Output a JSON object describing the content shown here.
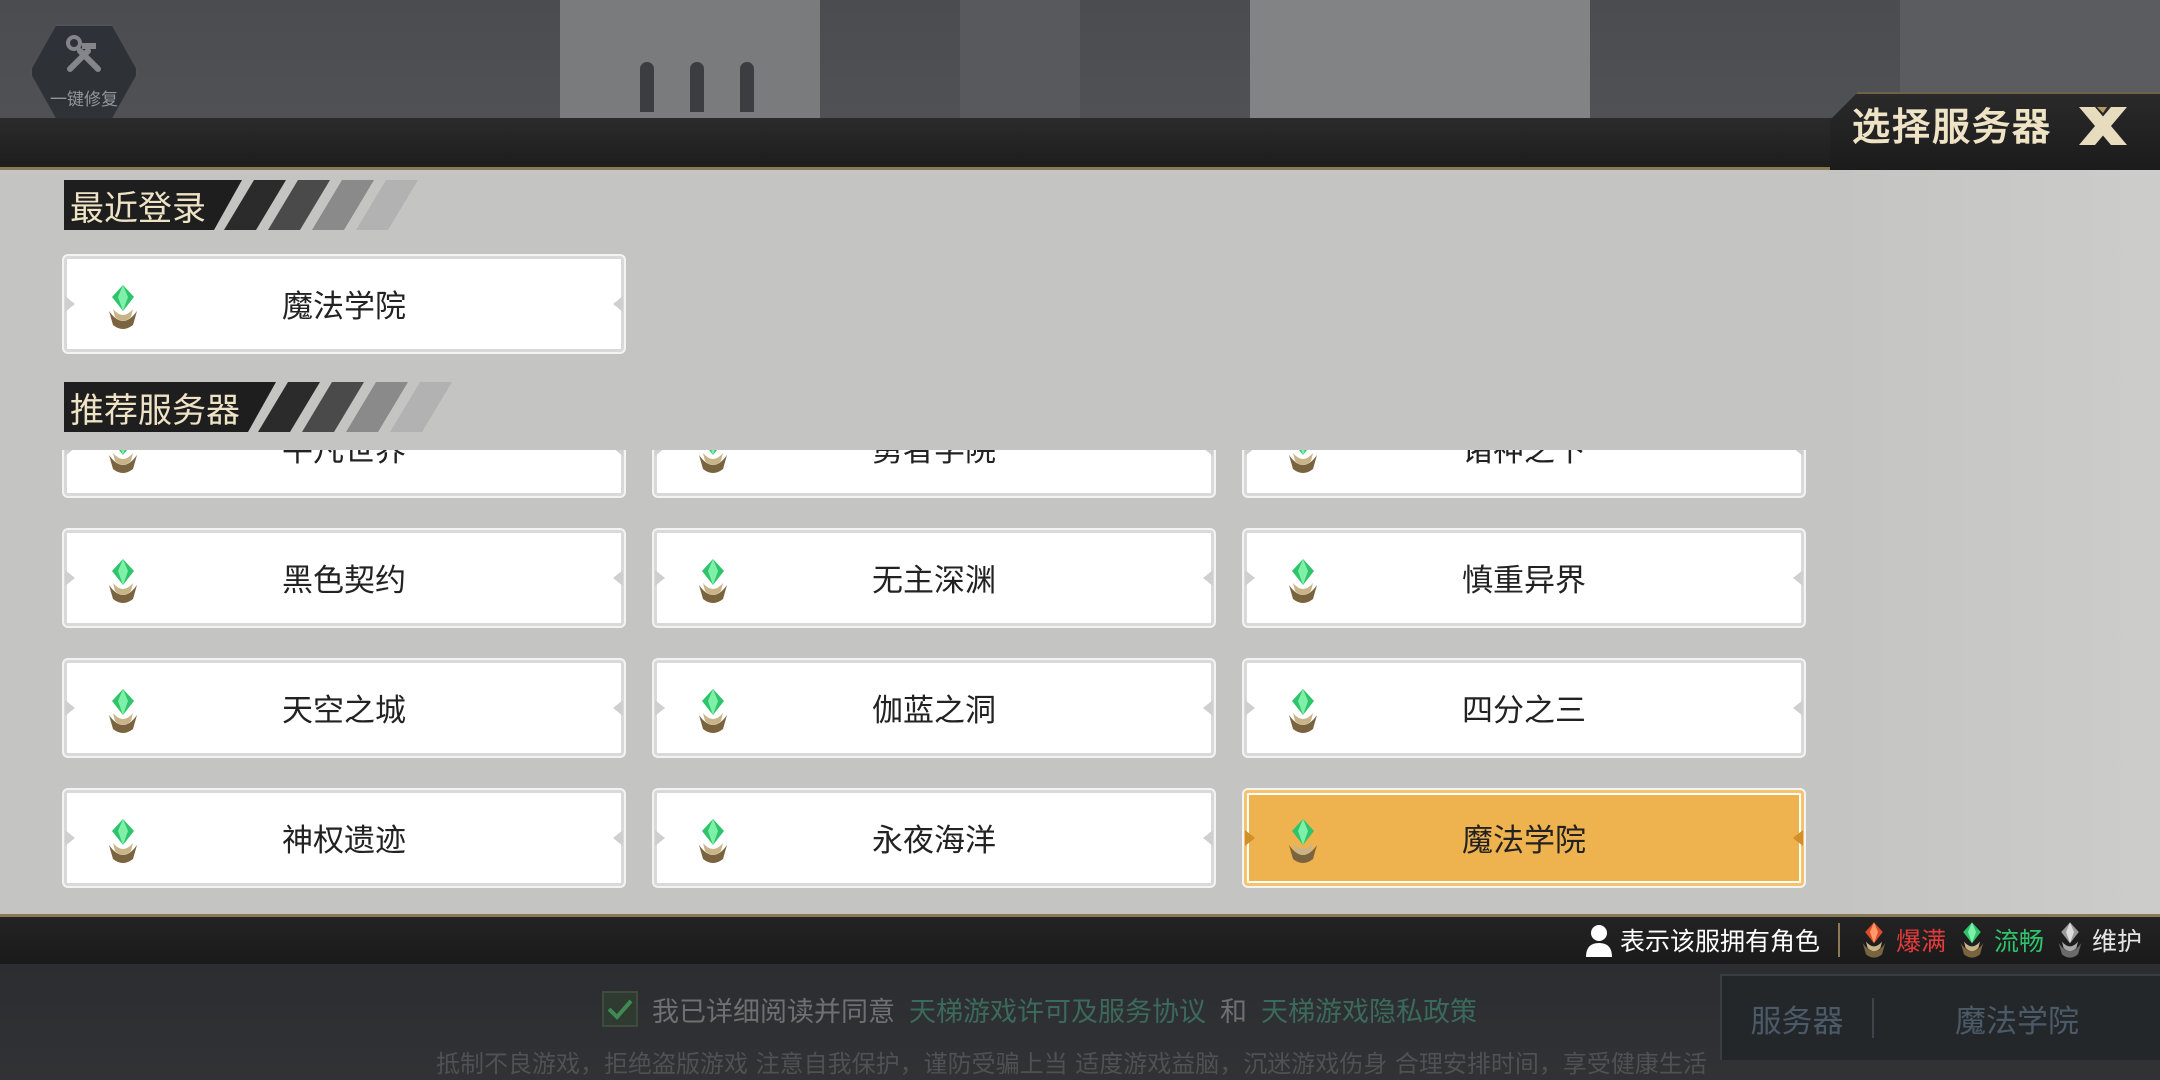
{
  "repair": {
    "label": "一键修复",
    "icon": "wrench-hammer-icon"
  },
  "header": {
    "title": "选择服务器",
    "close_icon": "close-x-icon"
  },
  "recent": {
    "section_label": "最近登录",
    "servers": [
      {
        "name": "魔法学院",
        "status": "smooth"
      }
    ]
  },
  "recommended": {
    "section_label": "推荐服务器",
    "rows": [
      [
        {
          "name": "平凡世界",
          "status": "smooth"
        },
        {
          "name": "勇者学院",
          "status": "smooth"
        },
        {
          "name": "诸神之下",
          "status": "smooth"
        }
      ],
      [
        {
          "name": "黑色契约",
          "status": "smooth"
        },
        {
          "name": "无主深渊",
          "status": "smooth"
        },
        {
          "name": "慎重异界",
          "status": "smooth"
        }
      ],
      [
        {
          "name": "天空之城",
          "status": "smooth"
        },
        {
          "name": "伽蓝之洞",
          "status": "smooth"
        },
        {
          "name": "四分之三",
          "status": "smooth"
        }
      ],
      [
        {
          "name": "神权遗迹",
          "status": "smooth"
        },
        {
          "name": "永夜海洋",
          "status": "smooth"
        },
        {
          "name": "魔法学院",
          "status": "smooth",
          "selected": true
        }
      ]
    ]
  },
  "legend": {
    "has_role": "表示该服拥有角色",
    "full": "爆满",
    "smooth": "流畅",
    "maintenance": "维护",
    "colors": {
      "full": "#e23b3b",
      "smooth": "#2fc46b",
      "maintenance": "#e6e6e6",
      "has_role": "#ffffff"
    }
  },
  "agreement": {
    "prefix": "我已详细阅读并同意",
    "license_link": "天梯游戏许可及服务协议",
    "and": "和",
    "privacy_link": "天梯游戏隐私政策",
    "checked": true
  },
  "notice": "抵制不良游戏，拒绝盗版游戏 注意自我保护，谨防受骗上当 适度游戏益脑，沉迷游戏伤身 合理安排时间，享受健康生活",
  "server_switch": {
    "label": "服务器",
    "current": "魔法学院"
  },
  "colors": {
    "accent_gold": "#8c7a56",
    "selected_card": "#eeb24f",
    "title_text": "#efe3c6"
  }
}
